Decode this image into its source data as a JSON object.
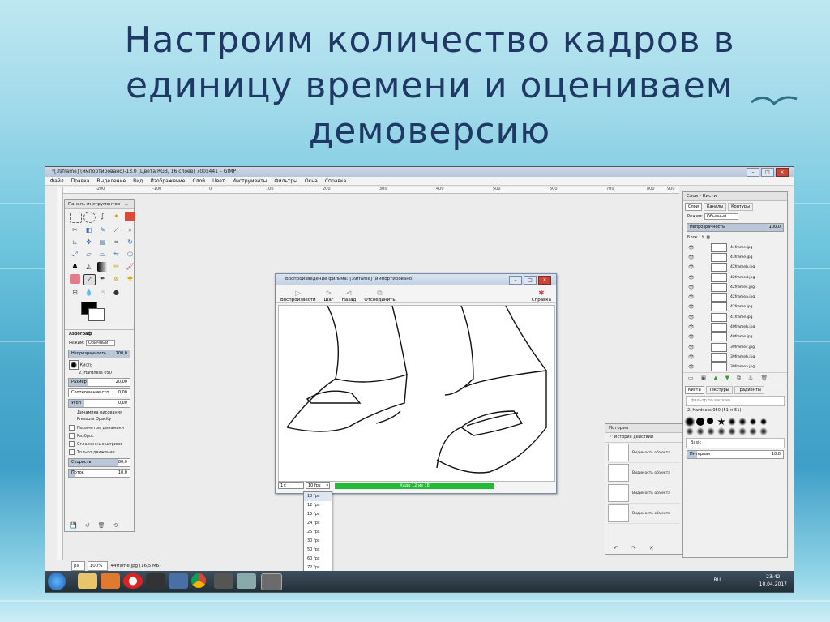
{
  "slide": {
    "title_lines": [
      "Настроим количество кадров в",
      "единицу времени и оцениваем",
      "демоверсию"
    ]
  },
  "gimp": {
    "window_title": "*[39frame] (импортировано)-13.0 (Цвета RGB, 16 слоев) 700x441 – GIMP",
    "menu": [
      "Файл",
      "Правка",
      "Выделение",
      "Вид",
      "Изображение",
      "Слой",
      "Цвет",
      "Инструменты",
      "Фильтры",
      "Окна",
      "Справка"
    ],
    "ruler_labels": [
      "-200",
      "-100",
      "0",
      "100",
      "200",
      "300",
      "400",
      "500",
      "600",
      "700",
      "800",
      "900"
    ],
    "status": {
      "unit": "px",
      "zoom": "100%",
      "file": "44frame.jpg (16,5 МБ)"
    }
  },
  "toolbox": {
    "title": "Панель инструментов - ...",
    "tool_name": "Аэрограф",
    "mode_label": "Режим:",
    "mode_value": "Обычный",
    "opacity_label": "Непрозрачность",
    "opacity_value": "100,0",
    "brush_label": "Кисть",
    "brush_value": "2. Hardness 050",
    "size_label": "Размер",
    "size_value": "20,00",
    "aspect_label": "Соотношение сто...",
    "aspect_value": "0,00",
    "angle_label": "Угол",
    "angle_value": "0,00",
    "dynamics_label": "Динамика рисования",
    "dynamics_value": "Pressure Opacity",
    "options": [
      "Параметры динамики",
      "Разброс",
      "Сглаженные штрихи",
      "Только движение"
    ],
    "rate_label": "Скорость",
    "rate_value": "80,0",
    "flow_label": "Поток",
    "flow_value": "10,0"
  },
  "movie": {
    "title": "Воспроизведение фильма: [39frame] (импортировано)",
    "buttons": [
      "Воспроизвести",
      "Шаг",
      "Назад",
      "Отсоединить",
      "Справка"
    ],
    "speed": "1×",
    "fps": "10 fps",
    "progress_text": "Кадр 12 из 16",
    "progress_fraction": 0.75,
    "fps_options": [
      "10 fps",
      "12 fps",
      "15 fps",
      "24 fps",
      "25 fps",
      "30 fps",
      "50 fps",
      "60 fps",
      "72 fps"
    ]
  },
  "history": {
    "title": "История",
    "tab": "История действий",
    "items": [
      "Видимость объекта",
      "Видимость объекта",
      "Видимость объекта",
      "Видимость объекта"
    ]
  },
  "layers": {
    "title": "Слои - Кисти",
    "tabs": [
      "Слои",
      "Каналы",
      "Контуры"
    ],
    "mode_label": "Режим:",
    "mode_value": "Обычный",
    "opacity_label": "Непрозрачность",
    "opacity_value": "100,0",
    "lock_label": "Блок.:",
    "items": [
      "44frame.jpg",
      "43frame.jpg",
      "42frameb.jpg",
      "42framed.jpg",
      "42framec.jpg",
      "42framea.jpg",
      "42frame.jpg",
      "41frame.jpg",
      "40frameb.jpg",
      "40frame.jpg",
      "39framec.jpg",
      "39frameb.jpg",
      "39framea.jpg"
    ],
    "brush_tabs": [
      "Кисти",
      "Текстуры",
      "Градиенты"
    ],
    "brush_filter": "фильтр по меткам",
    "brush_current": "2. Hardness 050 (51 × 51)",
    "brush_tag": "Basic",
    "spacing_label": "Интервал",
    "spacing_value": "10,0"
  },
  "taskbar": {
    "lang": "RU",
    "time": "23:42",
    "date": "10.04.2017"
  }
}
